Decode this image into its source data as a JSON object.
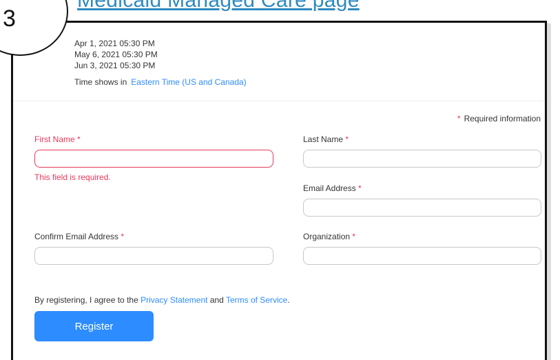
{
  "step_number": "3",
  "top_link_text": "Medicaid Managed Care page",
  "schedule": {
    "dates": [
      "Apr 1, 2021 05:30 PM",
      "May 6, 2021 05:30 PM",
      "Jun 3, 2021 05:30 PM"
    ],
    "timezone_prefix": "Time shows in",
    "timezone_link": "Eastern Time (US and Canada)"
  },
  "form": {
    "required_info": "Required information",
    "required_marker": "*",
    "first_name_label": "First Name",
    "first_name_error": "This field is required.",
    "last_name_label": "Last Name",
    "email_label": "Email Address",
    "confirm_email_label": "Confirm Email Address",
    "organization_label": "Organization",
    "agree_prefix": "By registering, I agree to the",
    "privacy_link": "Privacy Statement",
    "agree_and": "and",
    "terms_link": "Terms of Service",
    "agree_suffix": ".",
    "register_label": "Register"
  },
  "colors": {
    "accent": "#2d8cff",
    "error": "#e8385b",
    "link_top": "#2f8ac0"
  }
}
